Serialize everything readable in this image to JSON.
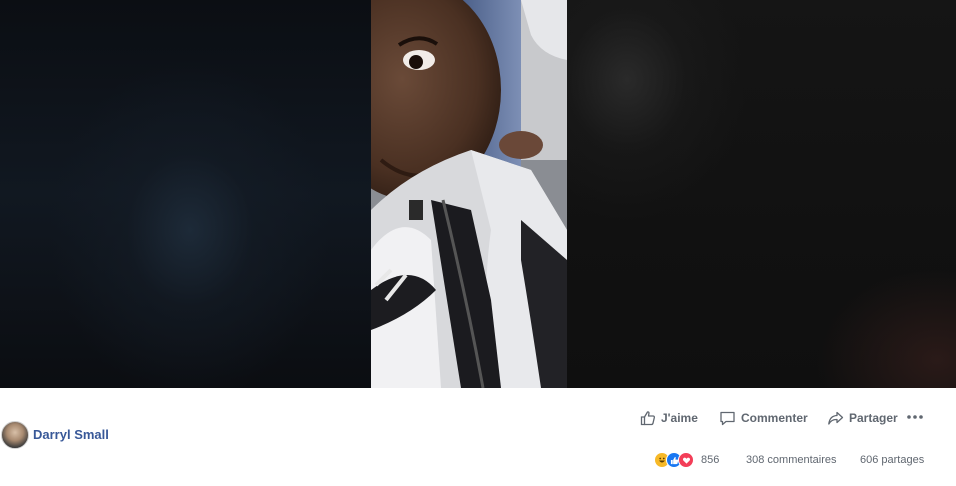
{
  "post": {
    "author_name": "Darryl Small"
  },
  "actions": {
    "like_label": "J'aime",
    "comment_label": "Commenter",
    "share_label": "Partager",
    "more_icon": "more-horizontal-icon"
  },
  "stats": {
    "reaction_icons": [
      "haha-reaction-icon",
      "like-reaction-icon",
      "love-reaction-icon"
    ],
    "reaction_count": "856",
    "comments": "308 commentaires",
    "shares": "606 partages"
  },
  "colors": {
    "author": "#385898",
    "action_text": "#606770",
    "like_blue": "#1877f2",
    "love_red": "#f33e58",
    "haha_yellow": "#f7b928"
  }
}
